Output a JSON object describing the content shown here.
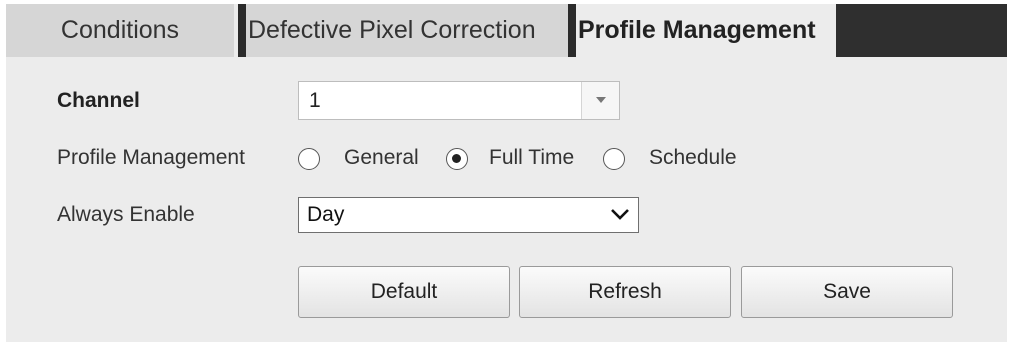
{
  "tabs": [
    {
      "label": "Conditions",
      "active": false
    },
    {
      "label": "Defective Pixel Correction",
      "active": false
    },
    {
      "label": "Profile Management",
      "active": true
    }
  ],
  "form": {
    "channel_label": "Channel",
    "channel_value": "1",
    "profile_label": "Profile Management",
    "profile_options": [
      {
        "label": "General",
        "selected": false
      },
      {
        "label": "Full Time",
        "selected": true
      },
      {
        "label": "Schedule",
        "selected": false
      }
    ],
    "always_enable_label": "Always Enable",
    "always_enable_value": "Day"
  },
  "buttons": {
    "default_label": "Default",
    "refresh_label": "Refresh",
    "save_label": "Save"
  },
  "icons": {
    "channel_dropdown": "chevron-down-icon",
    "always_enable_dropdown": "chevron-down-icon",
    "radio_selected": "radio-checked-icon",
    "radio_unselected": "radio-unchecked-icon"
  }
}
